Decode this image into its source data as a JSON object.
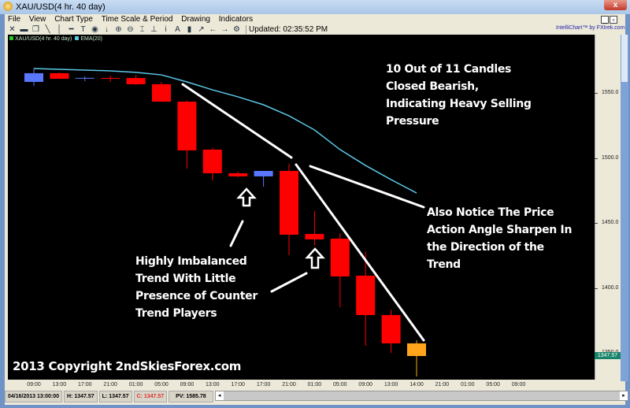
{
  "window": {
    "title": "XAU/USD(4 hr.  40 day)",
    "close_label": "x"
  },
  "menu": [
    "File",
    "View",
    "Chart Type",
    "Time Scale & Period",
    "Drawing",
    "Indicators"
  ],
  "toolbar": {
    "icons": [
      "crosshair-icon",
      "print-icon",
      "copy-icon",
      "line-tool-icon",
      "vertical-line-icon",
      "horizontal-line-icon",
      "text-tool-icon",
      "circle-tool-icon",
      "arrow-down-icon",
      "zoom-in-icon",
      "zoom-out-icon",
      "fit-icon",
      "baseline-icon",
      "info-icon",
      "font-icon",
      "bar-chart-icon",
      "indicator-icon",
      "arrow-left-icon",
      "arrow-right-icon",
      "settings-icon"
    ],
    "glyphs": [
      "✕",
      "▬",
      "❐",
      "╲",
      "│",
      "━",
      "T",
      "◉",
      "↓",
      "⊕",
      "⊖",
      "⌶",
      "⊥",
      "i",
      "A",
      "▮",
      "↗",
      "←",
      "→",
      "⚙"
    ],
    "updated": "Updated: 02:35:52 PM"
  },
  "brand": "IntelliChart™ by FXtrek.com",
  "legend": {
    "symbol": "XAU/USD(4 hr.  40 day)",
    "symbol_color": "#22cc22",
    "ema": "EMA(20)",
    "ema_color": "#5bc8e6"
  },
  "chart_data": {
    "type": "candlestick",
    "x_labels": [
      "09:00",
      "13:00",
      "17:00",
      "21:00",
      "01:00",
      "05:00",
      "09:00",
      "13:00",
      "17:00",
      "17:00",
      "21:00",
      "01:00",
      "05:00",
      "09:00",
      "13:00",
      "14:00",
      "21:00",
      "01:00",
      "05:00",
      "09:00"
    ],
    "y_ticks": [
      "1550.0",
      "1500.0",
      "1450.0",
      "1400.0",
      "1350.0"
    ],
    "y_tick_values": [
      1550,
      1500,
      1450,
      1400,
      1350
    ],
    "ylim": [
      1330,
      1580
    ],
    "colors": {
      "bull": "#5a78ff",
      "bear": "#ff0000",
      "current": "#ffa41b",
      "ema": "#5bc8e6"
    },
    "candles": [
      {
        "o": 1558.5,
        "h": 1568.8,
        "l": 1555.5,
        "c": 1565.2
      },
      {
        "o": 1565.2,
        "h": 1565.8,
        "l": 1560.9,
        "c": 1560.9
      },
      {
        "o": 1561.4,
        "h": 1562.7,
        "l": 1559.1,
        "c": 1561.6
      },
      {
        "o": 1561.5,
        "h": 1563.3,
        "l": 1558.5,
        "c": 1561.4
      },
      {
        "o": 1561.5,
        "h": 1563.9,
        "l": 1556.1,
        "c": 1556.7
      },
      {
        "o": 1556.7,
        "h": 1558.5,
        "l": 1543.3,
        "c": 1543.3
      },
      {
        "o": 1543.3,
        "h": 1543.9,
        "l": 1491.8,
        "c": 1505.8
      },
      {
        "o": 1506.4,
        "h": 1507.6,
        "l": 1482.7,
        "c": 1488.2
      },
      {
        "o": 1488.2,
        "h": 1489.4,
        "l": 1485.2,
        "c": 1485.8
      },
      {
        "o": 1485.8,
        "h": 1490.0,
        "l": 1477.9,
        "c": 1490.0
      },
      {
        "o": 1490.0,
        "h": 1495.5,
        "l": 1425.2,
        "c": 1440.9
      },
      {
        "o": 1441.5,
        "h": 1459.1,
        "l": 1432.4,
        "c": 1437.3
      },
      {
        "o": 1437.9,
        "h": 1442.1,
        "l": 1385.2,
        "c": 1408.8
      },
      {
        "o": 1409.4,
        "h": 1427.6,
        "l": 1355.5,
        "c": 1379.1
      },
      {
        "o": 1379.1,
        "h": 1383.3,
        "l": 1350.0,
        "c": 1357.3
      },
      {
        "o": 1357.3,
        "h": 1359.7,
        "l": 1331.8,
        "c": 1347.57
      }
    ],
    "ema": [
      1568.8,
      1568.2,
      1567.6,
      1567.0,
      1565.8,
      1563.9,
      1558.5,
      1552.4,
      1547.0,
      1540.9,
      1532.4,
      1521.5,
      1506.4,
      1494.2,
      1483.3,
      1473.0
    ],
    "current_price": "1347.57"
  },
  "annotations": {
    "top_right": [
      "10 Out of 11 Candles",
      "Closed Bearish,",
      "Indicating Heavy Selling",
      "Pressure"
    ],
    "right": [
      "Also Notice The Price",
      "Action Angle Sharpen In",
      "the Direction of the",
      "Trend"
    ],
    "left": [
      "Highly Imbalanced",
      "Trend With Little",
      "Presence of Counter",
      "Trend Players"
    ],
    "copyright": "2013 Copyright 2ndSkiesForex.com"
  },
  "status": {
    "datetime": "04/16/2013 13:00:00",
    "high": "H: 1347.57",
    "low": "L: 1347.57",
    "close": "C: 1347.57",
    "pv": "PV: 1585.78"
  }
}
